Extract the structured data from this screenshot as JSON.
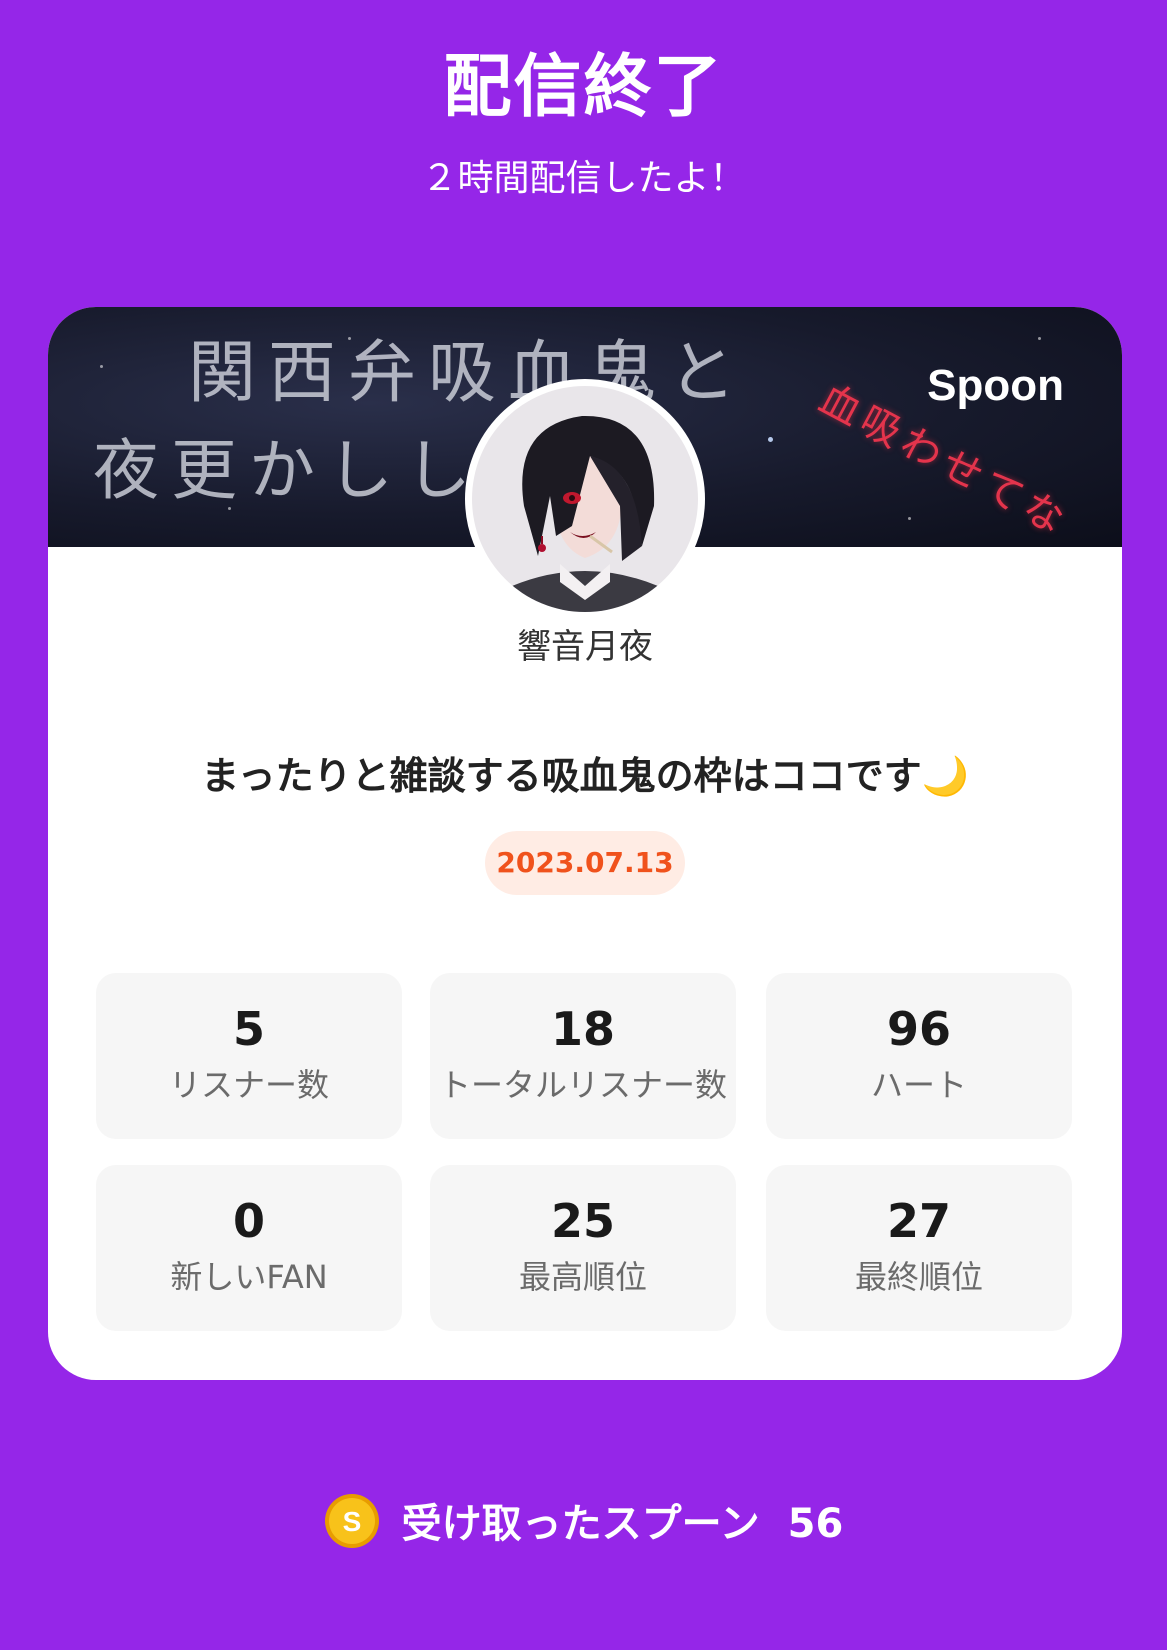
{
  "header": {
    "title": "配信終了",
    "subtitle": "２時間配信したよ！"
  },
  "banner": {
    "line1": "関西弁吸血鬼と",
    "line2": "夜更かししよか？",
    "red_text": "血吸わせてな",
    "brand": "Spoon"
  },
  "profile": {
    "username": "響音月夜"
  },
  "live": {
    "title": "まったりと雑談する吸血鬼の枠はココです🌙",
    "date": "2023.07.13"
  },
  "stats": [
    {
      "value": "5",
      "label": "リスナー数"
    },
    {
      "value": "18",
      "label": "トータルリスナー数"
    },
    {
      "value": "96",
      "label": "ハート"
    },
    {
      "value": "0",
      "label": "新しいFAN"
    },
    {
      "value": "25",
      "label": "最高順位"
    },
    {
      "value": "27",
      "label": "最終順位"
    }
  ],
  "footer": {
    "label": "受け取ったスプーン",
    "count": "56",
    "coin_symbol": "S"
  },
  "colors": {
    "background": "#9526e8",
    "date_accent": "#f0521c",
    "date_bg": "#ffece4",
    "coin": "#f5b400"
  }
}
